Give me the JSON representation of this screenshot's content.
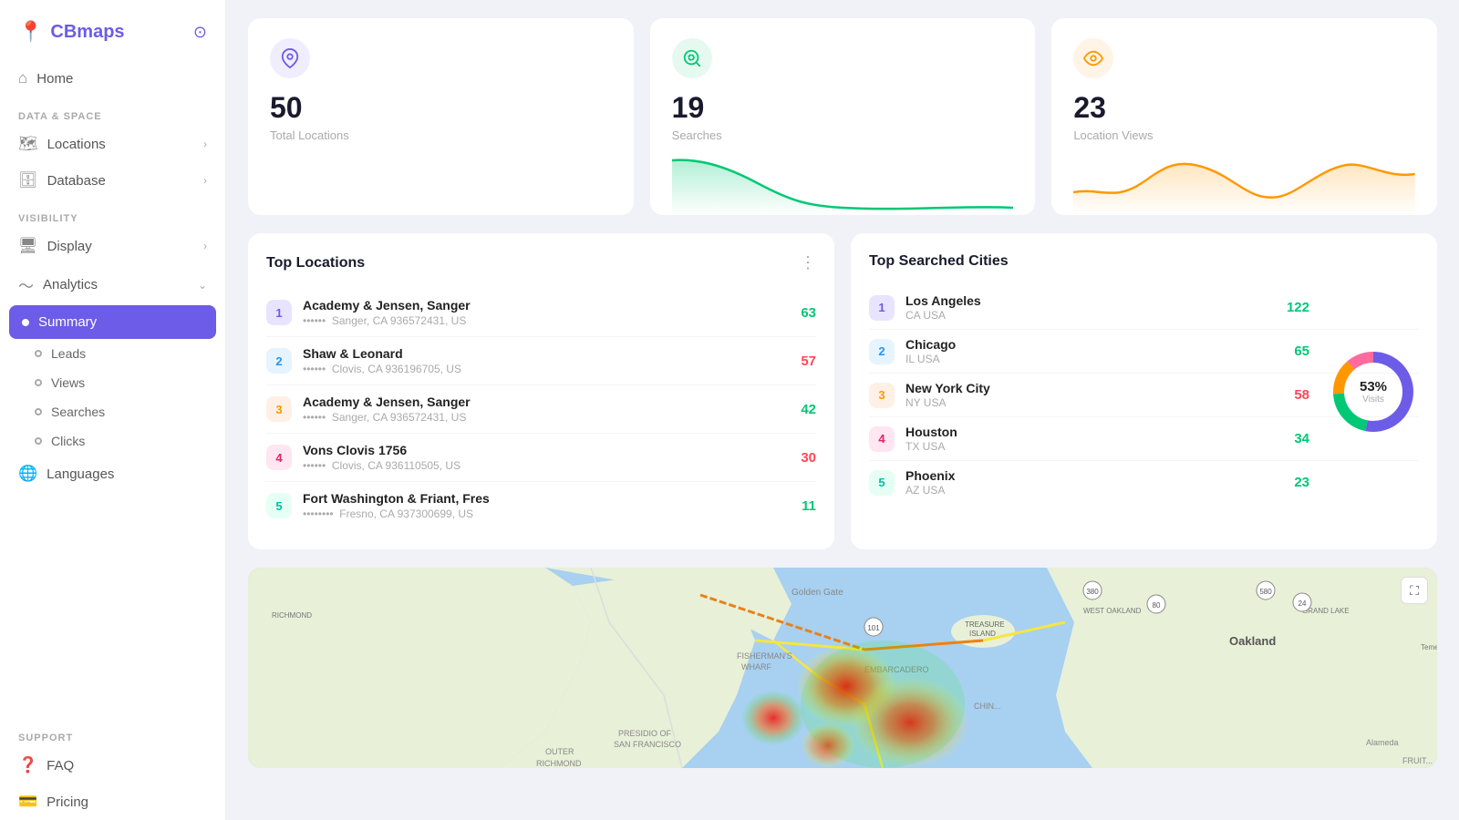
{
  "app": {
    "name": "CBmaps"
  },
  "sidebar": {
    "section_data": "DATA & SPACE",
    "section_visibility": "VISIBILITY",
    "section_support": "SUPPORT",
    "home_label": "Home",
    "locations_label": "Locations",
    "database_label": "Database",
    "display_label": "Display",
    "analytics_label": "Analytics",
    "summary_label": "Summary",
    "leads_label": "Leads",
    "views_label": "Views",
    "searches_label": "Searches",
    "clicks_label": "Clicks",
    "languages_label": "Languages",
    "faq_label": "FAQ",
    "pricing_label": "Pricing"
  },
  "stats": {
    "total_locations": "50",
    "total_locations_label": "Total Locations",
    "searches": "19",
    "searches_label": "Searches",
    "location_views": "23",
    "location_views_label": "Location Views"
  },
  "top_locations": {
    "title": "Top Locations",
    "items": [
      {
        "rank": "1",
        "name": "Academy & Jensen, Sanger",
        "addr": "••••••  Sanger, CA 936572431, US",
        "count": "63",
        "color": "green"
      },
      {
        "rank": "2",
        "name": "Shaw & Leonard",
        "addr": "••••••  Clovis, CA 936196705, US",
        "count": "57",
        "color": "red"
      },
      {
        "rank": "3",
        "name": "Academy & Jensen, Sanger",
        "addr": "••••••  Sanger, CA 936572431, US",
        "count": "42",
        "color": "green"
      },
      {
        "rank": "4",
        "name": "Vons Clovis 1756",
        "addr": "••••••  Clovis, CA 936110505, US",
        "count": "30",
        "color": "red"
      },
      {
        "rank": "5",
        "name": "Fort Washington & Friant, Fres",
        "addr": "••••••••  Fresno, CA 937300699, US",
        "count": "11",
        "color": "green"
      }
    ]
  },
  "top_cities": {
    "title": "Top Searched Cities",
    "donut_pct": "53%",
    "donut_label": "Visits",
    "items": [
      {
        "rank": "1",
        "name": "Los Angeles",
        "sub": "CA USA",
        "count": "122",
        "color": "green"
      },
      {
        "rank": "2",
        "name": "Chicago",
        "sub": "IL USA",
        "count": "65",
        "color": "green"
      },
      {
        "rank": "3",
        "name": "New York City",
        "sub": "NY USA",
        "count": "58",
        "color": "red"
      },
      {
        "rank": "4",
        "name": "Houston",
        "sub": "TX USA",
        "count": "34",
        "color": "green"
      },
      {
        "rank": "5",
        "name": "Phoenix",
        "sub": "AZ USA",
        "count": "23",
        "color": "green"
      }
    ]
  },
  "icons": {
    "logo": "📍",
    "settings": "⊙",
    "home": "⌂",
    "locations": "🗺",
    "database": "🗄",
    "display": "🖥",
    "analytics": "〜",
    "languages": "🌐",
    "faq": "❓",
    "pricing": "💳",
    "expand": "⛶",
    "three_dots": "⋮"
  },
  "colors": {
    "purple": "#6c5ce7",
    "green": "#00c875",
    "red": "#ff4757",
    "orange": "#ff9800"
  }
}
